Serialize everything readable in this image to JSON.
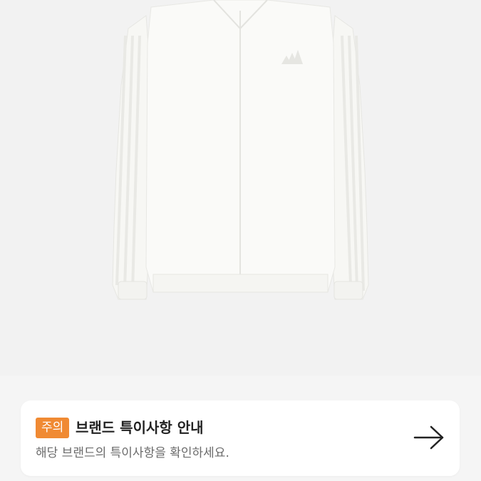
{
  "product": {
    "image_icon": "white-track-jacket-image"
  },
  "notice": {
    "badge": "주의",
    "title": "브랜드 특이사항 안내",
    "subtitle": "해당 브랜드의 특이사항을 확인하세요.",
    "arrow_icon": "arrow-right-icon",
    "badge_color": "#f08a33"
  }
}
